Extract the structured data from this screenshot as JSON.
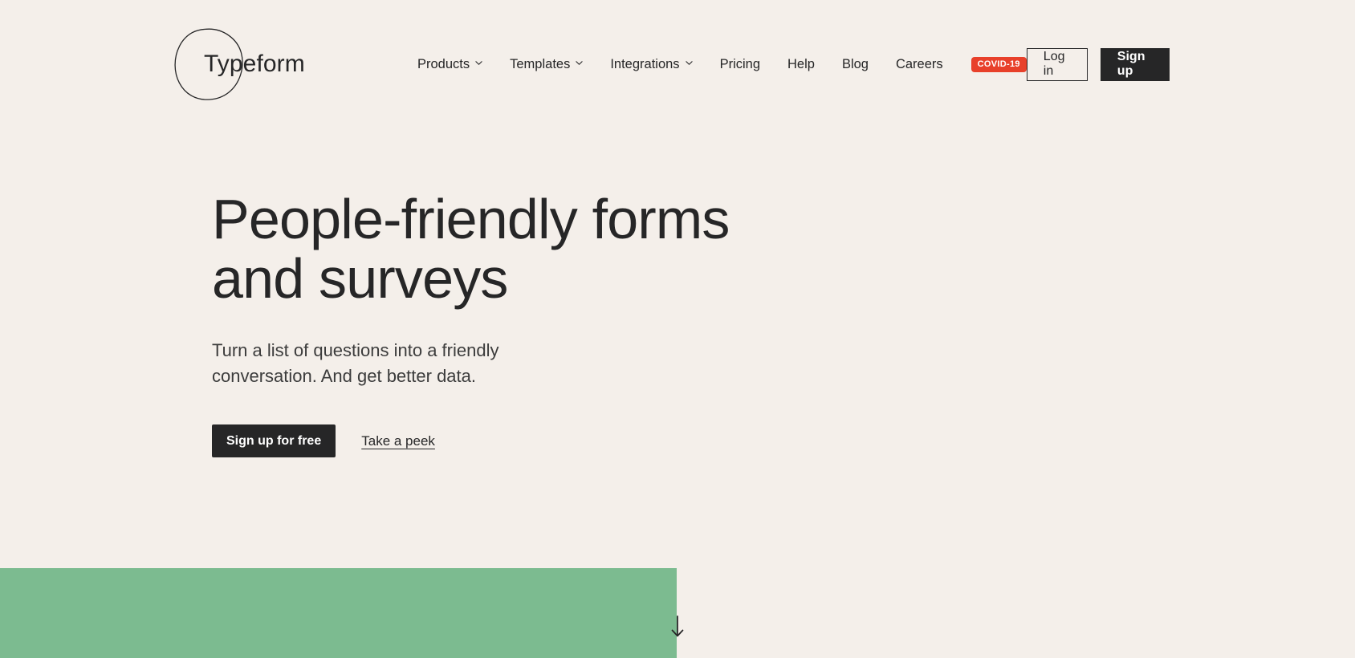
{
  "colors": {
    "background": "#F4EFEA",
    "text": "#262627",
    "accent_green": "#7CBB90",
    "badge_red": "#E8402A",
    "button_dark": "#262627"
  },
  "header": {
    "brand": {
      "name": "Typeform",
      "logo_icon": "hand-drawn-circle-icon"
    },
    "nav": [
      {
        "label": "Products",
        "has_dropdown": true,
        "icon": "chevron-down-icon"
      },
      {
        "label": "Templates",
        "has_dropdown": true,
        "icon": "chevron-down-icon"
      },
      {
        "label": "Integrations",
        "has_dropdown": true,
        "icon": "chevron-down-icon"
      },
      {
        "label": "Pricing",
        "has_dropdown": false
      },
      {
        "label": "Help",
        "has_dropdown": false
      },
      {
        "label": "Blog",
        "has_dropdown": false
      },
      {
        "label": "Careers",
        "has_dropdown": false
      }
    ],
    "covid_badge": "COVID-19",
    "login_label": "Log in",
    "signup_label": "Sign up"
  },
  "hero": {
    "title": "People-friendly forms\nand surveys",
    "subtitle": "Turn a list of questions into a friendly\nconversation. And get better data.",
    "primary_cta": "Sign up for free",
    "secondary_cta": "Take a peek"
  },
  "footer_section": {
    "scroll_icon": "arrow-down-icon"
  }
}
